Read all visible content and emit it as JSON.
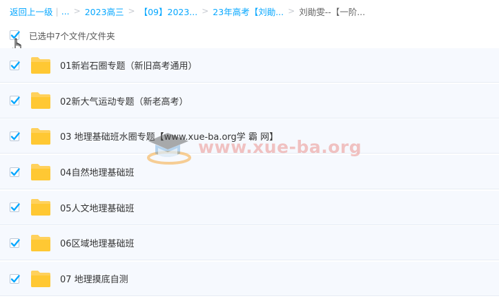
{
  "breadcrumb": {
    "back_label": "返回上一级",
    "pipe": "|",
    "ellipsis": "...",
    "sep": ">",
    "items": [
      "2023高三",
      "【09】2023...",
      "23年高考【刘勛...",
      "刘勛雯--【一阶..."
    ]
  },
  "selection": {
    "status_text": "已选中7个文件/文件夹",
    "select_all_checked": true
  },
  "files": [
    {
      "name": "01新岩石圈专题（新旧高考通用）",
      "checked": true
    },
    {
      "name": "02新大气运动专题（新老高考）",
      "checked": true
    },
    {
      "name": "03 地理基础班水圈专题【www.xue-ba.org学 霸 网】",
      "checked": true
    },
    {
      "name": "04自然地理基础班",
      "checked": true
    },
    {
      "name": "05人文地理基础班",
      "checked": true
    },
    {
      "name": "06区域地理基础班",
      "checked": true
    },
    {
      "name": "07 地理摸底自测",
      "checked": true
    }
  ],
  "watermark": {
    "text": "www.xue-ba.org"
  },
  "colors": {
    "accent": "#06a7ff",
    "folder": "#ffd15c",
    "row_bg": "#f6f9fe"
  }
}
